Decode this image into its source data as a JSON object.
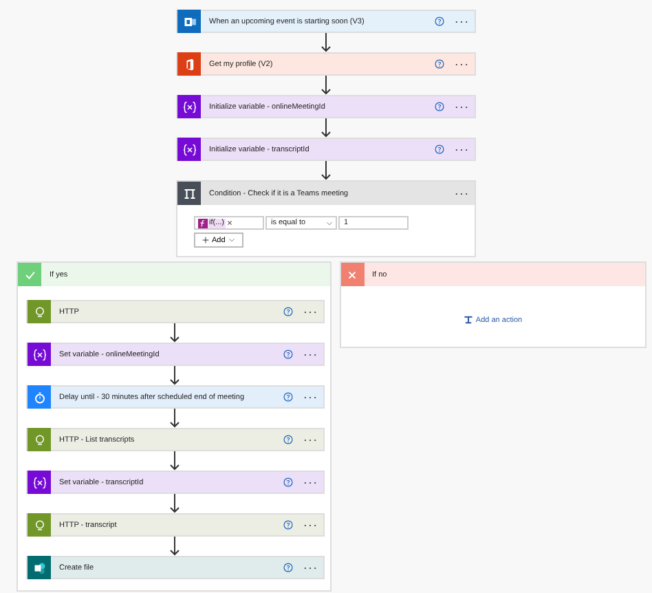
{
  "steps": [
    {
      "kind": "outlook",
      "title": "When an upcoming event is starting soon (V3)"
    },
    {
      "kind": "office",
      "title": "Get my profile (V2)"
    },
    {
      "kind": "variable",
      "title": "Initialize variable - onlineMeetingId"
    },
    {
      "kind": "variable",
      "title": "Initialize variable - transcriptId"
    }
  ],
  "condition": {
    "title": "Condition - Check if it is a Teams meeting",
    "token": "if(...)",
    "operator": "is equal to",
    "value": "1",
    "add": "Add"
  },
  "if_yes": {
    "title": "If yes",
    "steps": [
      {
        "kind": "http",
        "title": "HTTP"
      },
      {
        "kind": "variable",
        "title": "Set variable - onlineMeetingId"
      },
      {
        "kind": "delay",
        "title": "Delay until - 30 minutes after scheduled end of meeting"
      },
      {
        "kind": "http",
        "title": "HTTP - List transcripts"
      },
      {
        "kind": "variable",
        "title": "Set variable - transcriptId"
      },
      {
        "kind": "http",
        "title": "HTTP - transcript"
      },
      {
        "kind": "sharepoint",
        "title": "Create file"
      }
    ]
  },
  "if_no": {
    "title": "If no",
    "add_action": "Add an action"
  }
}
